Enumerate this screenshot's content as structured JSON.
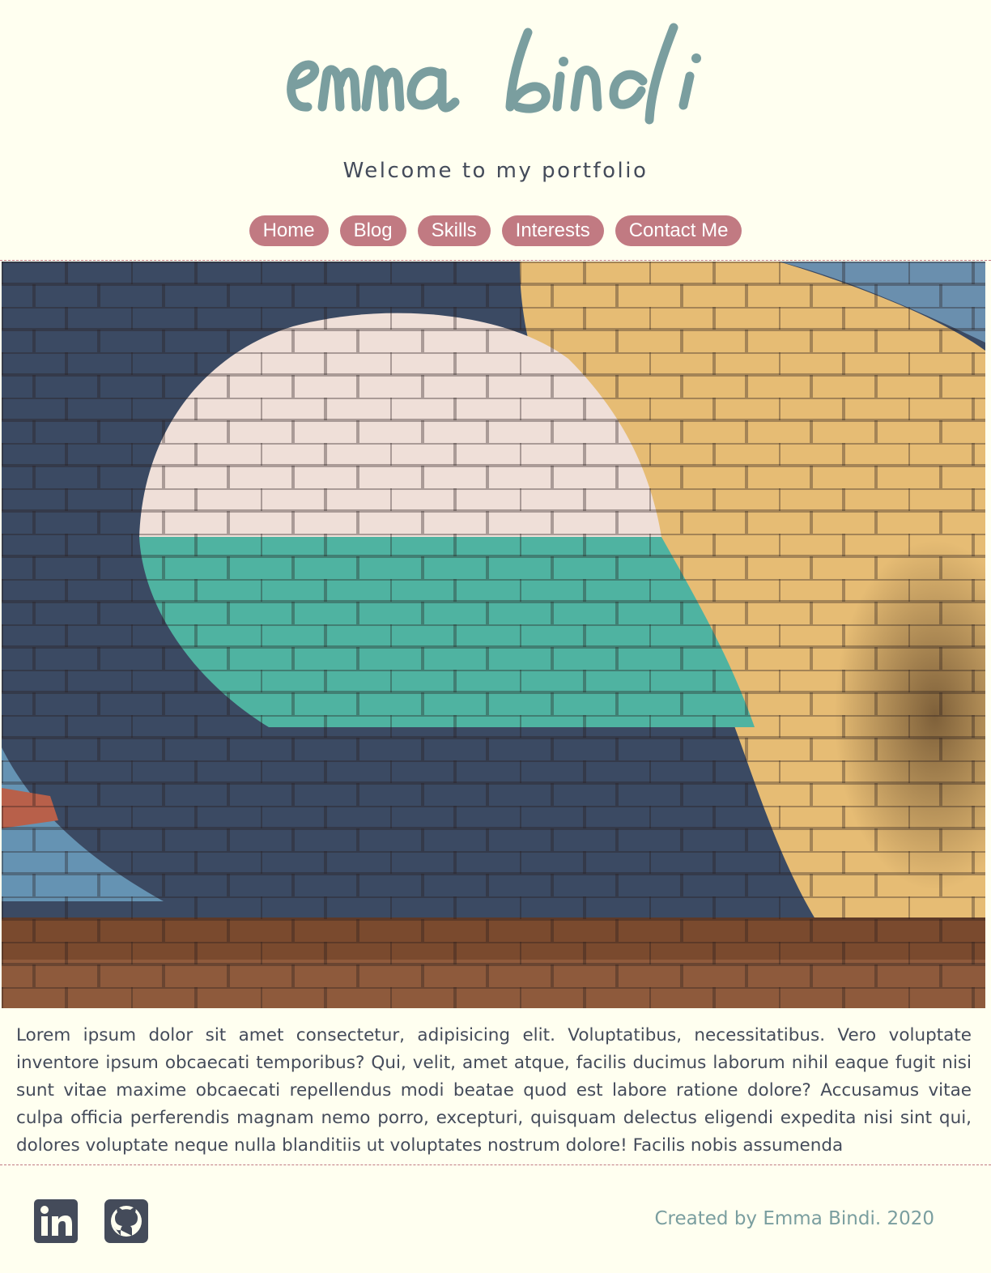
{
  "header": {
    "logo_text": "emma bindi",
    "tagline": "Welcome to my portfolio"
  },
  "nav": {
    "items": [
      {
        "label": "Home"
      },
      {
        "label": "Blog"
      },
      {
        "label": "Skills"
      },
      {
        "label": "Interests"
      },
      {
        "label": "Contact Me"
      }
    ]
  },
  "bio": {
    "text": "Lorem ipsum dolor sit amet consectetur, adipisicing elit. Voluptatibus, necessitatibus. Vero voluptate inventore ipsum obcaecati temporibus? Qui, velit, amet atque, facilis ducimus laborum nihil eaque fugit nisi sunt vitae maxime obcaecati repellendus modi beatae quod est labore ratione dolore? Accusamus vitae culpa officia perferendis magnam nemo porro, excepturi, quisquam delectus eligendi expedita nisi sint qui, dolores voluptate neque nulla blanditiis ut voluptates nostrum dolore! Facilis nobis assumenda"
  },
  "footer": {
    "social": [
      {
        "icon": "linkedin-icon"
      },
      {
        "icon": "github-icon"
      }
    ],
    "credit": "Created by Emma Bindi. 2020"
  },
  "colors": {
    "background": "#fffff0",
    "accent": "#c17a82",
    "logo": "#7a9e9f",
    "text": "#444b5a"
  }
}
